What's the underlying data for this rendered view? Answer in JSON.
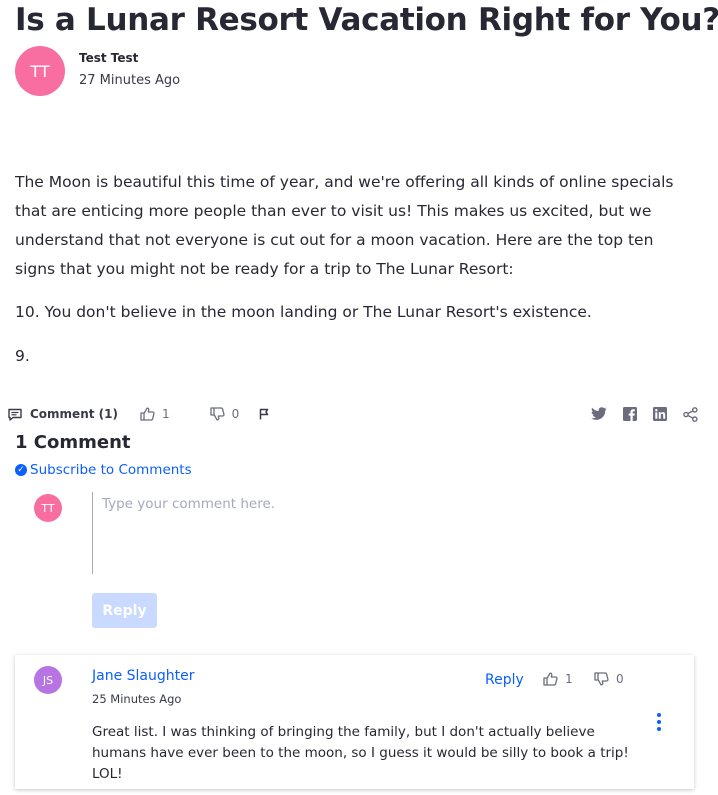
{
  "article": {
    "title": "Is a Lunar Resort Vacation Right for You?",
    "author_initials": "TT",
    "author_name": "Test Test",
    "posted": "27 Minutes Ago",
    "body": [
      "The Moon is beautiful this time of year, and we're offering all kinds of online specials that are enticing more people than ever to visit us! This makes us excited, but we understand that not everyone is cut out for a moon vacation. Here are the top ten signs that you might not be ready for a trip to The Lunar Resort:",
      "10. You don't believe in the moon landing or The Lunar Resort's existence.",
      "9."
    ]
  },
  "actions": {
    "comment_label": "Comment (1)",
    "likes": "1",
    "dislikes": "0",
    "icons": [
      "comment-icon",
      "thumbs-up-icon",
      "thumbs-down-icon",
      "flag-icon",
      "twitter-icon",
      "facebook-icon",
      "linkedin-icon",
      "share-icon"
    ]
  },
  "comments_section": {
    "heading": "1 Comment",
    "subscribe_label": "Subscribe to Comments",
    "current_user_initials": "TT",
    "input_placeholder": "Type your comment here.",
    "reply_button": "Reply"
  },
  "comments": [
    {
      "initials": "JS",
      "author": "Jane Slaughter",
      "time": "25 Minutes Ago",
      "reply_label": "Reply",
      "likes": "1",
      "dislikes": "0",
      "text": "Great list. I was thinking of bringing the family, but I don't actually believe humans have ever been to the moon, so I guess it would be silly to book a trip! LOL!"
    }
  ],
  "colors": {
    "accent": "#0b5fff",
    "avatar_tt": "#f96ea0",
    "avatar_js": "#b774e3",
    "reply_disabled": "#c9d9ff",
    "icon_gray": "#6b6c7e"
  }
}
